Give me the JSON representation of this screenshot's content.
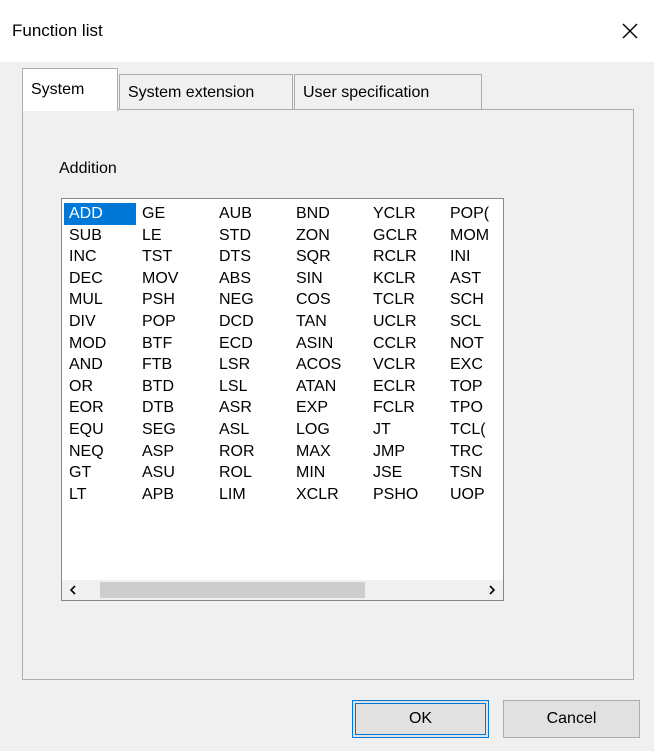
{
  "dialog": {
    "title": "Function list",
    "close_symbol": "✕"
  },
  "tabs": [
    {
      "label": "System",
      "active": true
    },
    {
      "label": "System extension",
      "active": false
    },
    {
      "label": "User specification",
      "active": false
    }
  ],
  "section_label": "Addition",
  "list": {
    "selected": "ADD",
    "columns": [
      [
        "ADD",
        "SUB",
        "INC",
        "DEC",
        "MUL",
        "DIV",
        "MOD",
        "AND",
        "OR",
        "EOR",
        "EQU",
        "NEQ",
        "GT",
        "LT"
      ],
      [
        "GE",
        "LE",
        "TST",
        "MOV",
        "PSH",
        "POP",
        "BTF",
        "FTB",
        "BTD",
        "DTB",
        "SEG",
        "ASP",
        "ASU",
        "APB"
      ],
      [
        "AUB",
        "STD",
        "DTS",
        "ABS",
        "NEG",
        "DCD",
        "ECD",
        "LSR",
        "LSL",
        "ASR",
        "ASL",
        "ROR",
        "ROL",
        "LIM"
      ],
      [
        "BND",
        "ZON",
        "SQR",
        "SIN",
        "COS",
        "TAN",
        "ASIN",
        "ACOS",
        "ATAN",
        "EXP",
        "LOG",
        "MAX",
        "MIN",
        "XCLR"
      ],
      [
        "YCLR",
        "GCLR",
        "RCLR",
        "KCLR",
        "TCLR",
        "UCLR",
        "CCLR",
        "VCLR",
        "ECLR",
        "FCLR",
        "JT",
        "JMP",
        "JSE",
        "PSHO"
      ],
      [
        "POP(",
        "MOM",
        "INI",
        "AST",
        "SCH",
        "SCL",
        "NOT",
        "EXC",
        "TOP",
        "TPO",
        "TCL(",
        "TRC",
        "TSN",
        "UOP"
      ]
    ],
    "scroll_left": "<",
    "scroll_right": ">"
  },
  "buttons": {
    "ok": "OK",
    "cancel": "Cancel"
  }
}
